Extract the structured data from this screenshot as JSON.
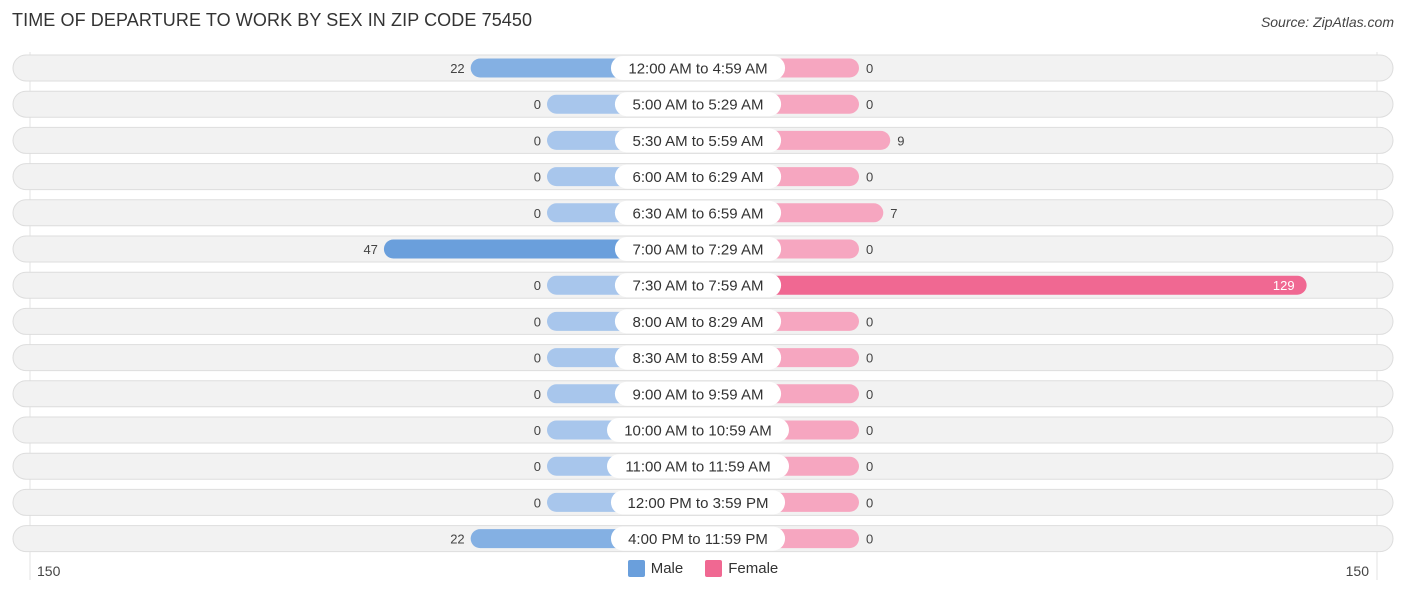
{
  "title": "TIME OF DEPARTURE TO WORK BY SEX IN ZIP CODE 75450",
  "source": "Source: ZipAtlas.com",
  "colors": {
    "male_strong": "#6a9fdc",
    "male_light": "#a8c6ec",
    "female_strong": "#f06892",
    "female_light": "#f6a6c0",
    "row_bg": "#f2f2f2",
    "row_border": "#dddddd"
  },
  "chart_data": {
    "type": "bar",
    "orientation": "horizontal-diverging",
    "title": "TIME OF DEPARTURE TO WORK BY SEX IN ZIP CODE 75450",
    "categories": [
      "12:00 AM to 4:59 AM",
      "5:00 AM to 5:29 AM",
      "5:30 AM to 5:59 AM",
      "6:00 AM to 6:29 AM",
      "6:30 AM to 6:59 AM",
      "7:00 AM to 7:29 AM",
      "7:30 AM to 7:59 AM",
      "8:00 AM to 8:29 AM",
      "8:30 AM to 8:59 AM",
      "9:00 AM to 9:59 AM",
      "10:00 AM to 10:59 AM",
      "11:00 AM to 11:59 AM",
      "12:00 PM to 3:59 PM",
      "4:00 PM to 11:59 PM"
    ],
    "series": [
      {
        "name": "Male",
        "values": [
          22,
          0,
          0,
          0,
          0,
          47,
          0,
          0,
          0,
          0,
          0,
          0,
          0,
          22
        ]
      },
      {
        "name": "Female",
        "values": [
          0,
          0,
          9,
          0,
          7,
          0,
          129,
          0,
          0,
          0,
          0,
          0,
          0,
          0
        ]
      }
    ],
    "axis": {
      "left_label": "150",
      "right_label": "150",
      "range": [
        -150,
        150
      ]
    },
    "legend": {
      "position": "bottom-center",
      "entries": [
        "Male",
        "Female"
      ]
    },
    "grid": false
  }
}
